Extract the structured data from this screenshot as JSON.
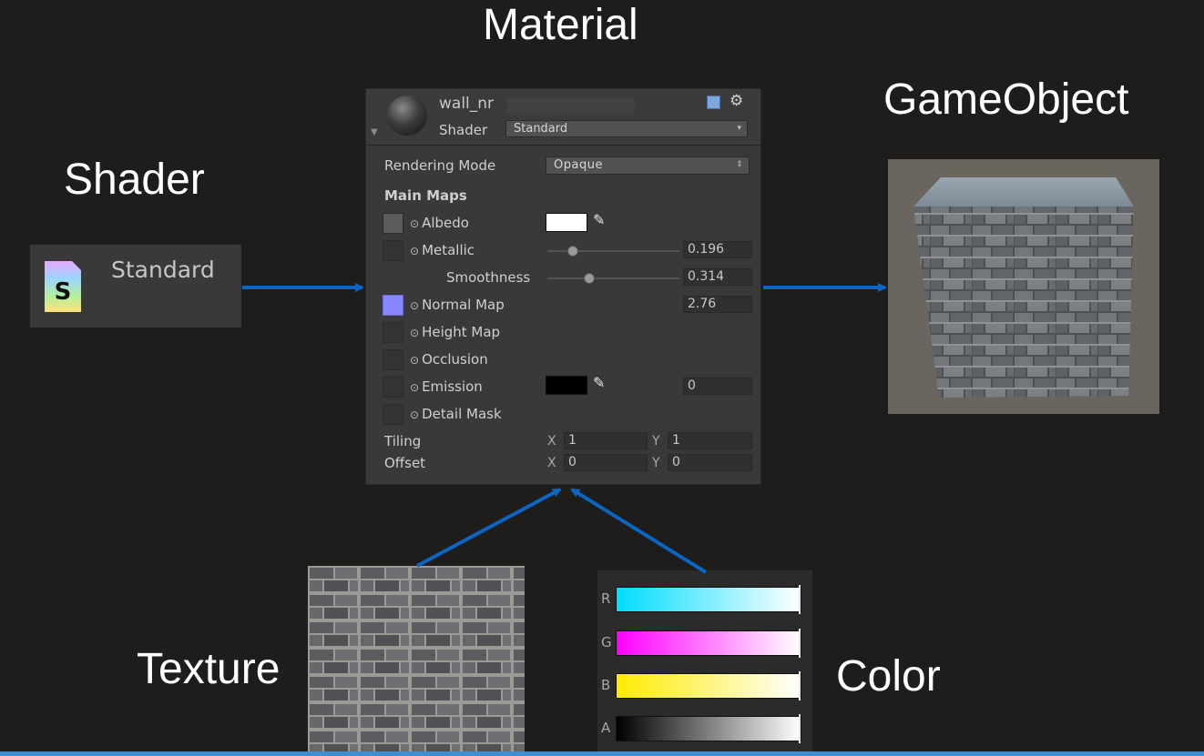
{
  "labels": {
    "material": "Material",
    "gameobject": "GameObject",
    "shader": "Shader",
    "texture": "Texture",
    "color": "Color"
  },
  "shader_card": {
    "name": "Standard",
    "icon": "shader-file-icon"
  },
  "inspector": {
    "material_name": "wall_nr",
    "shader_label": "Shader",
    "shader_value": "Standard",
    "rendering_mode_label": "Rendering Mode",
    "rendering_mode_value": "Opaque",
    "main_maps_title": "Main Maps",
    "rows": {
      "albedo": {
        "label": "Albedo",
        "color": "#ffffff"
      },
      "metallic": {
        "label": "Metallic",
        "value": "0.196",
        "slider_fraction": 0.196
      },
      "smoothness": {
        "label": "Smoothness",
        "value": "0.314",
        "slider_fraction": 0.314
      },
      "normal_map": {
        "label": "Normal Map",
        "value": "2.76"
      },
      "height_map": {
        "label": "Height Map"
      },
      "occlusion": {
        "label": "Occlusion"
      },
      "emission": {
        "label": "Emission",
        "color": "#000000",
        "value": "0"
      },
      "detail_mask": {
        "label": "Detail Mask"
      }
    },
    "tiling": {
      "label": "Tiling",
      "x_label": "X",
      "x": "1",
      "y_label": "Y",
      "y": "1"
    },
    "offset": {
      "label": "Offset",
      "x_label": "X",
      "x": "0",
      "y_label": "Y",
      "y": "0"
    }
  },
  "color_picker": {
    "channels": [
      {
        "label": "R",
        "start": "#00dcff",
        "end": "#ffffff"
      },
      {
        "label": "G",
        "start": "#ff00ff",
        "end": "#ffffff"
      },
      {
        "label": "B",
        "start": "#ffea00",
        "end": "#ffffff"
      },
      {
        "label": "A",
        "start": "#000000",
        "end": "#ffffff"
      }
    ]
  },
  "colors": {
    "arrow": "#0a66c2",
    "background": "#1f1c1c",
    "normal_map_swatch": "#8787ff"
  }
}
